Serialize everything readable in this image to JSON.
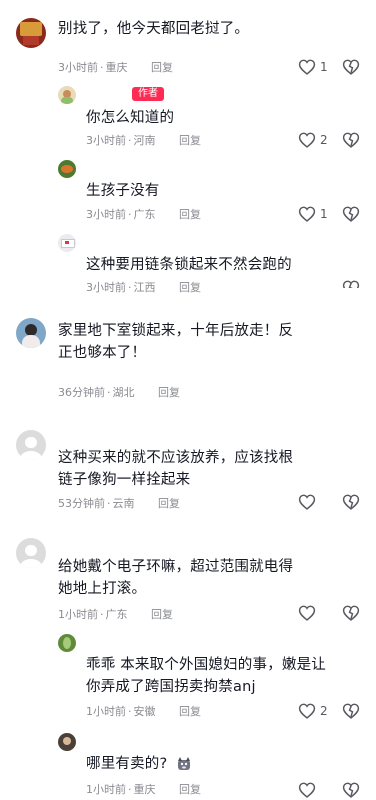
{
  "comments": [
    {
      "kind": "top",
      "avatar": "avatar-photo-red",
      "text": "别找了，他今天都回老挝了。",
      "time": "3小时前",
      "location": "重庆",
      "reply": "回复",
      "likes": "1"
    },
    {
      "kind": "sub",
      "avatar": "avatar-photo-child",
      "author_badge": "作者",
      "text": "你怎么知道的",
      "time": "3小时前",
      "location": "河南",
      "reply": "回复",
      "likes": "2"
    },
    {
      "kind": "sub",
      "avatar": "avatar-photo-food",
      "text": "生孩子没有",
      "time": "3小时前",
      "location": "广东",
      "reply": "回复",
      "likes": "1"
    },
    {
      "kind": "sub",
      "avatar": "avatar-photo-card",
      "text": "这种要用链条锁起来不然会跑的",
      "time": "3小时前",
      "location": "江西",
      "reply": "回复",
      "likes": ""
    },
    {
      "kind": "top",
      "avatar": "avatar-photo-person",
      "text": "家里地下室锁起来，十年后放走！反正也够本了！",
      "time": "36分钟前",
      "location": "湖北",
      "reply": "回复",
      "likes": ""
    },
    {
      "kind": "top",
      "avatar": "avatar-default",
      "text": "这种买来的就不应该放养，应该找根链子像狗一样拴起来",
      "time": "53分钟前",
      "location": "云南",
      "reply": "回复",
      "likes": ""
    },
    {
      "kind": "top",
      "avatar": "avatar-default",
      "text": "给她戴个电子环嘛，超过范围就电得她地上打滚。",
      "time": "1小时前",
      "location": "广东",
      "reply": "回复",
      "likes": ""
    },
    {
      "kind": "sub",
      "avatar": "avatar-photo-plant",
      "text": "乖乖 本来取个外国媳妇的事，嫩是让你弄成了跨国拐卖拘禁anj",
      "time": "1小时前",
      "location": "安徽",
      "reply": "回复",
      "likes": "2"
    },
    {
      "kind": "sub",
      "avatar": "avatar-photo-dark",
      "text": "哪里有卖的?",
      "time": "1小时前",
      "location": "重庆",
      "reply": "回复",
      "likes": ""
    }
  ],
  "colors": {
    "text": "#161823",
    "meta": "#8a8b91",
    "badge": "#fe2c55",
    "icon": "#57585e"
  }
}
